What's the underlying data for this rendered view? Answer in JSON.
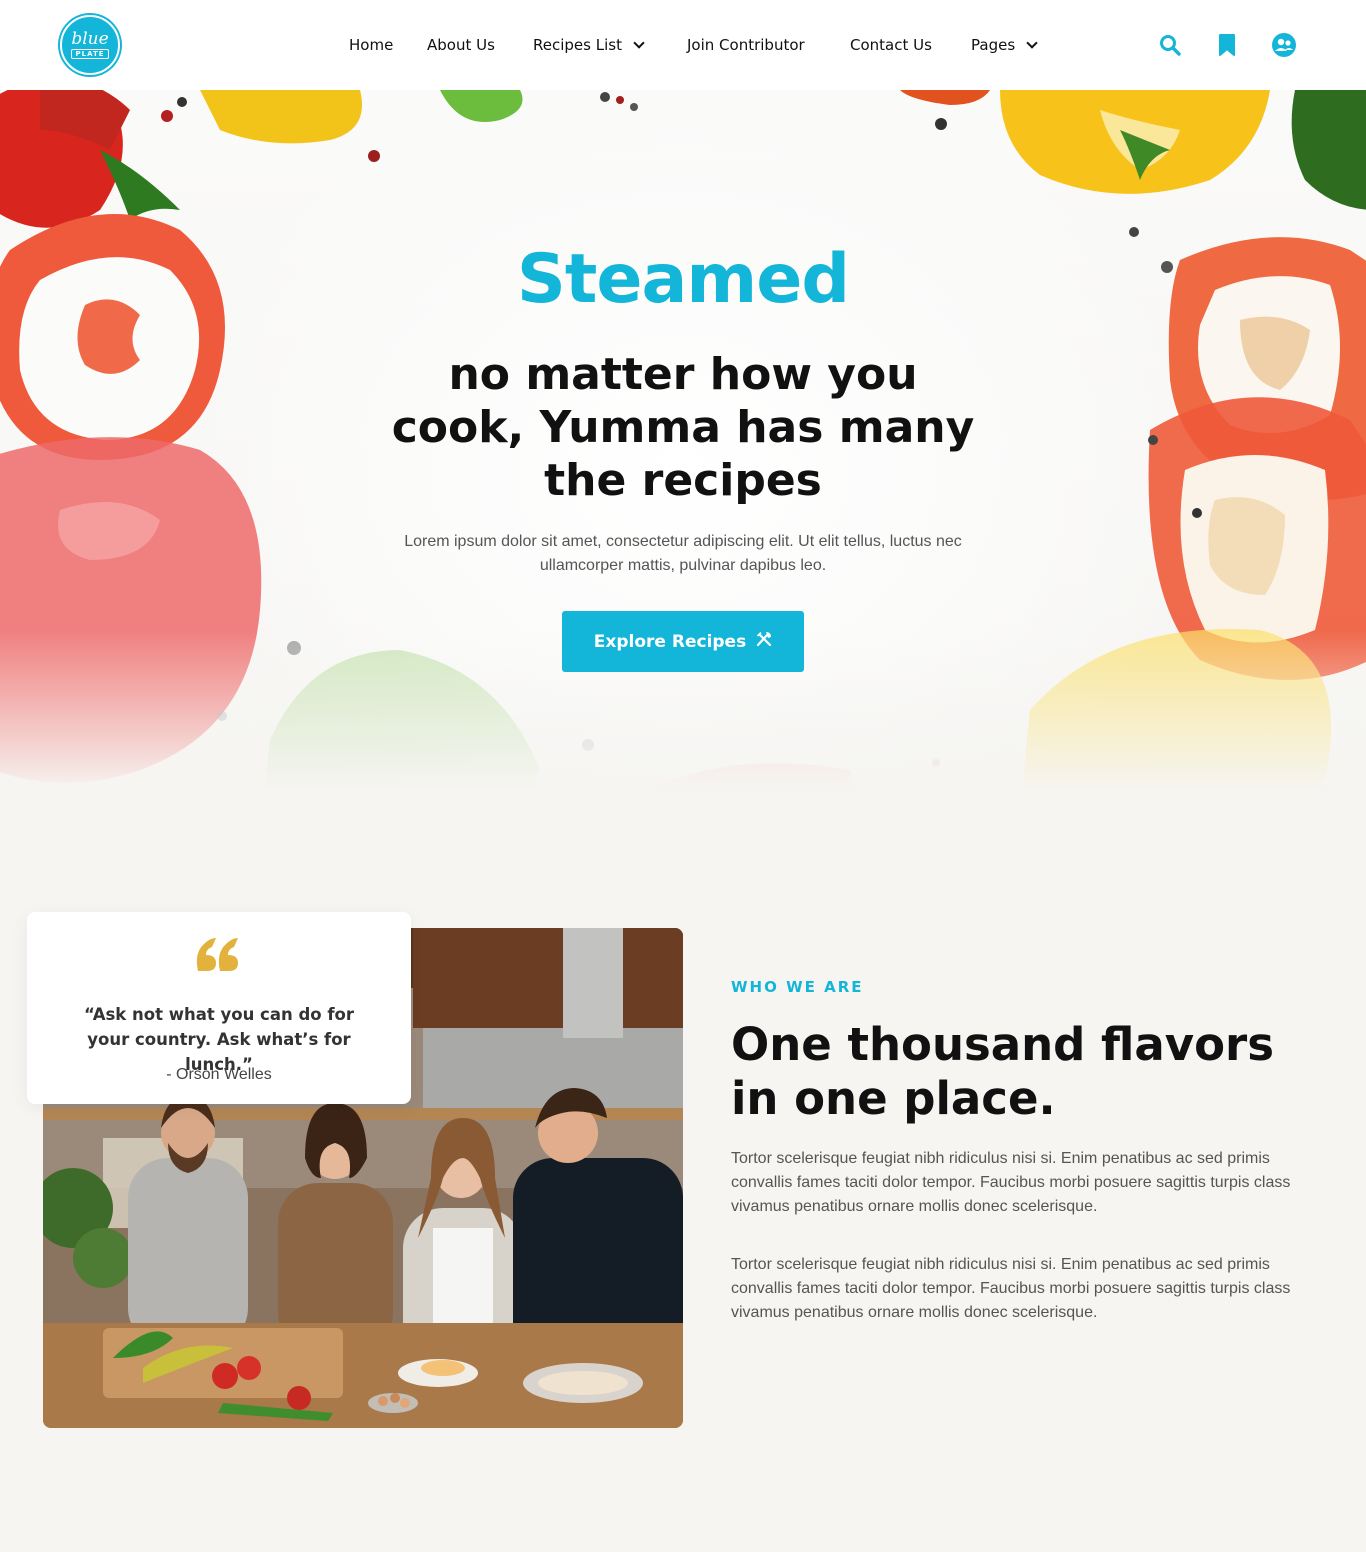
{
  "brand": {
    "logo_line1": "blue",
    "logo_line2": "PLATE",
    "accent_color": "#13b5d8"
  },
  "nav": {
    "items": [
      {
        "label": "Home",
        "has_dropdown": false
      },
      {
        "label": "About Us",
        "has_dropdown": false
      },
      {
        "label": "Recipes List",
        "has_dropdown": true
      },
      {
        "label": "Join Contributor",
        "has_dropdown": false
      },
      {
        "label": "Contact Us",
        "has_dropdown": false
      },
      {
        "label": "Pages",
        "has_dropdown": true
      }
    ],
    "icons": [
      "search-icon",
      "bookmark-icon",
      "user-icon"
    ]
  },
  "hero": {
    "title": "Steamed",
    "heading": "no matter how you cook, Yumma has many the recipes",
    "text": "Lorem ipsum dolor sit amet, consectetur adipiscing elit. Ut elit tellus, luctus nec ullamcorper mattis, pulvinar dapibus leo.",
    "button_label": "Explore Recipes",
    "button_icon": "utensils-icon"
  },
  "about": {
    "quote": "“Ask not what you can do for your country. Ask what’s for lunch.”",
    "quote_author": "- Orson Welles",
    "quote_color": "#e3b23c",
    "eyebrow": "WHO WE ARE",
    "title": "One thousand flavors in one place.",
    "paragraphs": [
      "Tortor scelerisque feugiat nibh ridiculus nisi si. Enim penatibus ac sed primis convallis fames taciti dolor tempor. Faucibus morbi posuere sagittis turpis class vivamus penatibus ornare mollis donec scelerisque.",
      "Tortor scelerisque feugiat nibh ridiculus nisi si. Enim penatibus ac sed primis convallis fames taciti dolor tempor. Faucibus morbi posuere sagittis turpis class vivamus penatibus ornare mollis donec scelerisque."
    ]
  }
}
